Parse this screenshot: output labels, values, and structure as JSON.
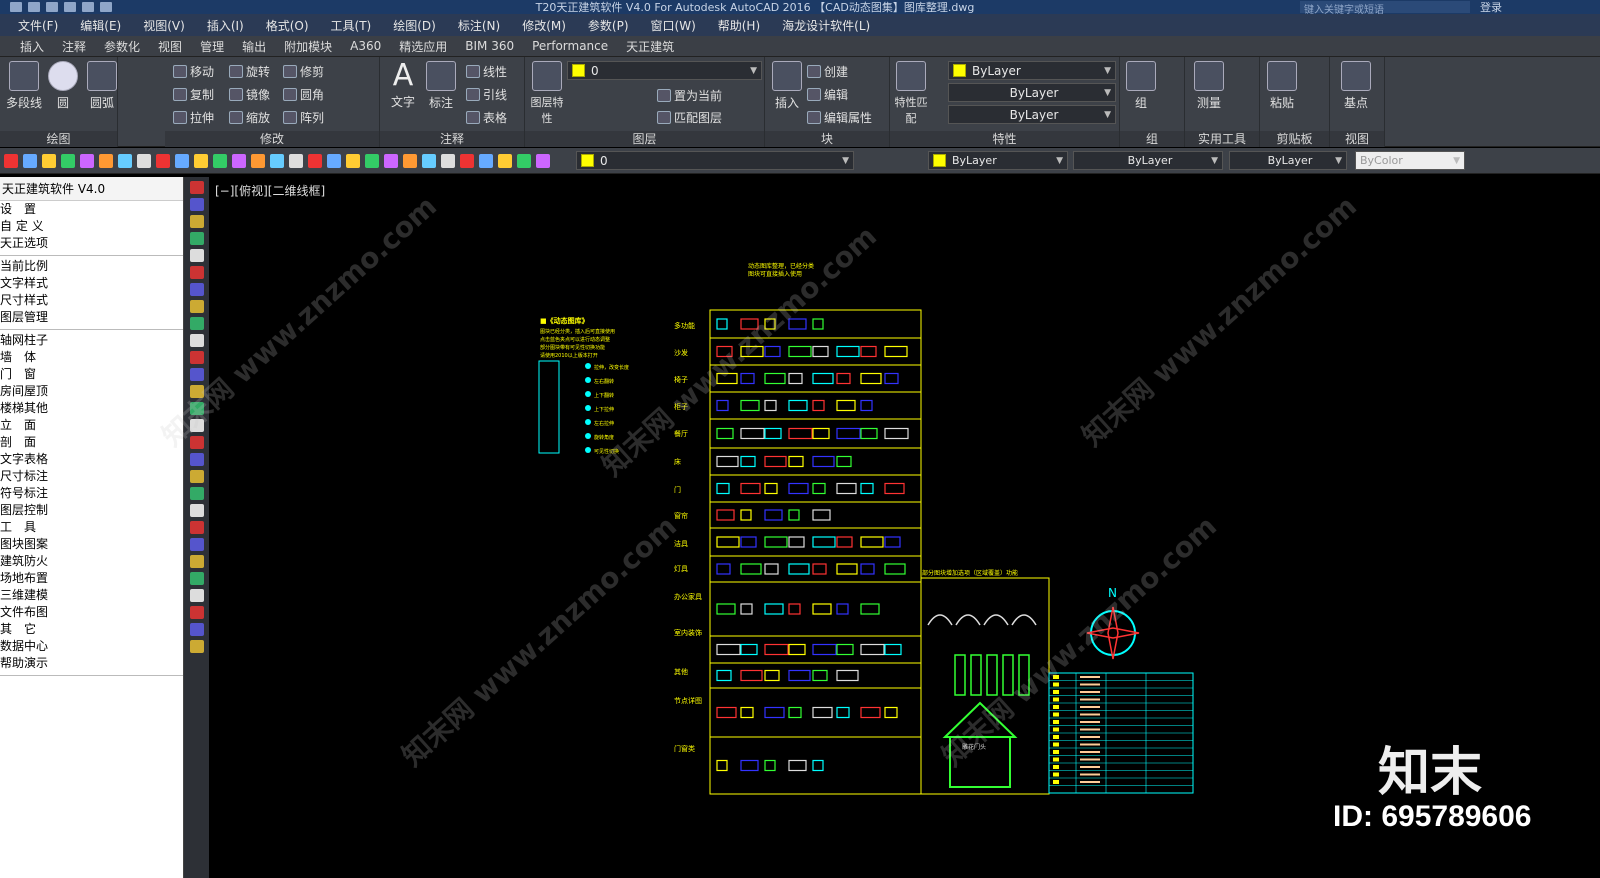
{
  "titlebar": {
    "title": "T20天正建筑软件 V4.0 For Autodesk AutoCAD 2016      【CAD动态图集】图库整理.dwg",
    "search_placeholder": "键入关键字或短语",
    "login": "登录"
  },
  "menu": [
    "文件(F)",
    "编辑(E)",
    "视图(V)",
    "插入(I)",
    "格式(O)",
    "工具(T)",
    "绘图(D)",
    "标注(N)",
    "修改(M)",
    "参数(P)",
    "窗口(W)",
    "帮助(H)",
    "海龙设计软件(L)"
  ],
  "tabs": [
    "插入",
    "注释",
    "参数化",
    "视图",
    "管理",
    "输出",
    "附加模块",
    "A360",
    "精选应用",
    "BIM 360",
    "Performance",
    "天正建筑"
  ],
  "ribbon": {
    "draw": {
      "polyline": "多段线",
      "circle": "圆",
      "arc": "圆弧",
      "title": "绘图"
    },
    "modify": {
      "move": "移动",
      "rotate": "旋转",
      "trim": "修剪",
      "copy": "复制",
      "mirror": "镜像",
      "fillet": "圆角",
      "stretch": "拉伸",
      "scale": "缩放",
      "array": "阵列",
      "title": "修改"
    },
    "annotate": {
      "text": "文字",
      "dim": "标注",
      "linear": "线性",
      "leader": "引线",
      "table": "表格",
      "title": "注释"
    },
    "layers": {
      "layer_props": "图层特性",
      "current_layer": "0",
      "set_current": "置为当前",
      "match_layer": "匹配图层",
      "title": "图层"
    },
    "block": {
      "insert": "插入",
      "create": "创建",
      "edit": "编辑",
      "edit_attr": "编辑属性",
      "title": "块"
    },
    "properties": {
      "match": "特性匹配",
      "color": "ByLayer",
      "linetype": "ByLayer",
      "lineweight": "ByLayer",
      "title": "特性"
    },
    "group": {
      "group": "组",
      "title": "组"
    },
    "utilities": {
      "measure": "测量",
      "title": "实用工具"
    },
    "clipboard": {
      "paste": "粘贴",
      "title": "剪贴板"
    },
    "view": {
      "base": "基点",
      "title": "视图"
    }
  },
  "toolbar2": {
    "layer": "0",
    "color": "ByLayer",
    "linetype": "ByLayer",
    "lineweight": "ByLayer",
    "plotstyle": "ByColor"
  },
  "palette": {
    "title": "天正建筑软件 V4.0",
    "items": [
      "设　置",
      "自 定 义",
      "天正选项",
      "当前比例",
      "文字样式",
      "尺寸样式",
      "图层管理",
      "轴网柱子",
      "墙　体",
      "门　窗",
      "房间屋顶",
      "楼梯其他",
      "立　面",
      "剖　面",
      "文字表格",
      "尺寸标注",
      "符号标注",
      "图层控制",
      "工　具",
      "图块图案",
      "建筑防火",
      "场地布置",
      "三维建模",
      "文件布图",
      "其　它",
      "数据中心",
      "帮助演示"
    ]
  },
  "viewport": {
    "label": "[−][俯视][二维线框]"
  },
  "drawing": {
    "note1": "动态图库整理，已经分类",
    "note2": "图块可直接插入使用",
    "legend_title": "■《动态图库》",
    "legend_lines": [
      "图块已经分类，插入后可直接使用",
      "点击蓝色夹点可以进行动态调整",
      "部分图块带有可见性切换功能",
      "请使用2010以上版本打开"
    ],
    "legend_items": [
      "拉伸，改变长度",
      "左右翻转",
      "上下翻转",
      "上下拉伸",
      "左右拉伸",
      "旋转角度",
      "可见性切换"
    ],
    "rows": [
      "多功能",
      "沙发",
      "椅子",
      "柜子",
      "餐厅",
      "床",
      "门",
      "窗帘",
      "洁具",
      "灯具",
      "办公家具",
      "室内装饰",
      "其他",
      "节点详图",
      "门窗类"
    ],
    "right_title": "部分图块增加选项（区域覆盖）功能",
    "north": "N",
    "gate_text": "雕花门头",
    "logo": "知末",
    "id": "ID: 695789606"
  }
}
